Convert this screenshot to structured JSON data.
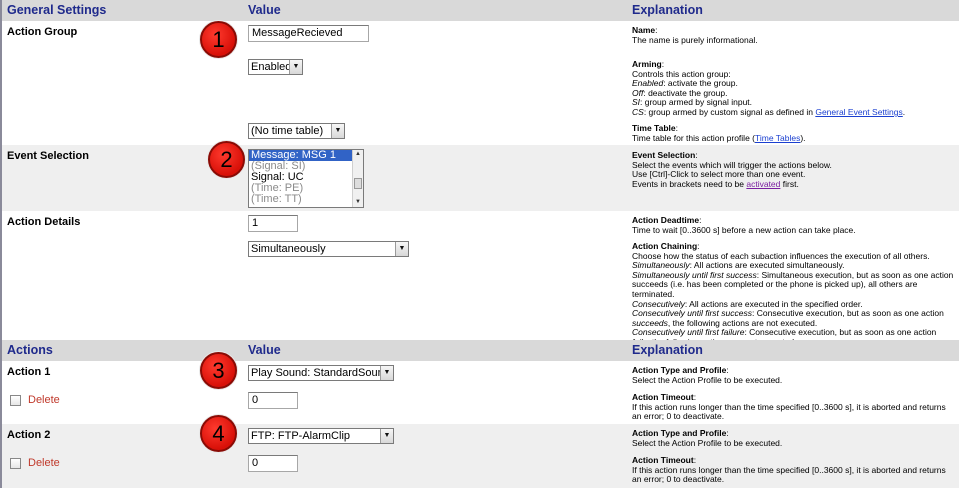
{
  "general_header": {
    "col1": "General Settings",
    "col2": "Value",
    "col3": "Explanation"
  },
  "action_group": {
    "label": "Action Group",
    "name_value": "MessageRecieved",
    "arming_value": "Enabled",
    "timetable_value": "(No time table)",
    "exp_name_title": "Name",
    "exp_name_text": "The name is purely informational.",
    "exp_arming_title": "Arming",
    "exp_arming_line1": "Controls this action group:",
    "exp_arming_enabled_term": "Enabled",
    "exp_arming_enabled_text": ": activate the group.",
    "exp_arming_off_term": "Off",
    "exp_arming_off_text": ": deactivate the group.",
    "exp_arming_si_term": "SI",
    "exp_arming_si_text": ": group armed by signal input.",
    "exp_arming_cs_term": "CS",
    "exp_arming_cs_text": ": group armed by custom signal as defined in ",
    "exp_arming_cs_link": "General Event Settings",
    "exp_tt_title": "Time Table",
    "exp_tt_text": "Time table for this action profile (",
    "exp_tt_link": "Time Tables",
    "exp_tt_end": ")."
  },
  "event_selection": {
    "label": "Event Selection",
    "options": [
      {
        "text": "Message: MSG 1",
        "state": "sel"
      },
      {
        "text": "(Signal: SI)",
        "state": "dim"
      },
      {
        "text": "Signal: UC",
        "state": "normal"
      },
      {
        "text": "(Time: PE)",
        "state": "dim"
      },
      {
        "text": "(Time: TT)",
        "state": "dim"
      }
    ],
    "exp_title": "Event Selection",
    "exp_line1": "Select the events which will trigger the actions below.",
    "exp_line2": "Use [Ctrl]-Click to select more than one event.",
    "exp_line3": "Events in brackets need to be ",
    "exp_link": "activated",
    "exp_line3_end": " first."
  },
  "action_details": {
    "label": "Action Details",
    "deadtime_value": "1",
    "chaining_value": "Simultaneously",
    "exp_deadtime_title": "Action Deadtime",
    "exp_deadtime_text": "Time to wait [0..3600 s] before a new action can take place.",
    "exp_chain_title": "Action Chaining",
    "exp_chain_line1": "Choose how the status of each subaction influences the execution of all others.",
    "exp_chain_sim_term": "Simultaneously",
    "exp_chain_sim_text": ": All actions are executed simultaneously.",
    "exp_chain_simu_term": "Simultaneously until first success",
    "exp_chain_simu_text": ": Simultaneous execution, but as soon as one action succeeds (i.e. has been completed or the phone is picked up), all others are terminated.",
    "exp_chain_con_term": "Consecutively",
    "exp_chain_con_text": ": All actions are executed in the specified order.",
    "exp_chain_cons_term": "Consecutively until first success",
    "exp_chain_cons_text_a": ": Consecutive execution, but as soon as one action ",
    "exp_chain_cons_em": "succeeds",
    "exp_chain_cons_text_b": ", the following actions are not executed.",
    "exp_chain_conf_term": "Consecutively until first failure",
    "exp_chain_conf_text_a": ": Consecutive execution, but as soon as one action ",
    "exp_chain_conf_em": "fails",
    "exp_chain_conf_text_b": ", the following actions are not executed."
  },
  "actions_header": {
    "col1": "Actions",
    "col2": "Value",
    "col3": "Explanation"
  },
  "actions": [
    {
      "label": "Action 1",
      "delete_label": "Delete",
      "profile_value": "Play Sound: StandardSounds",
      "timeout_value": "0",
      "exp_type_title": "Action Type and Profile",
      "exp_type_text": "Select the Action Profile to be executed.",
      "exp_timeout_title": "Action Timeout",
      "exp_timeout_text": "If this action runs longer than the time specified [0..3600 s], it is aborted and returns an error; 0 to deactivate."
    },
    {
      "label": "Action 2",
      "delete_label": "Delete",
      "profile_value": "FTP: FTP-AlarmClip",
      "timeout_value": "0",
      "exp_type_title": "Action Type and Profile",
      "exp_type_text": "Select the Action Profile to be executed.",
      "exp_timeout_title": "Action Timeout",
      "exp_timeout_text": "If this action runs longer than the time specified [0..3600 s], it is aborted and returns an error; 0 to deactivate."
    }
  ],
  "badges": [
    "1",
    "2",
    "3",
    "4"
  ],
  "colors": {
    "header_text": "#1f2a8c",
    "header_bg": "#d9d9d9",
    "row_alt_bg": "#efefef",
    "delete_text": "#c0392b",
    "badge": "#e01a10",
    "link": "#1a3fd0"
  }
}
